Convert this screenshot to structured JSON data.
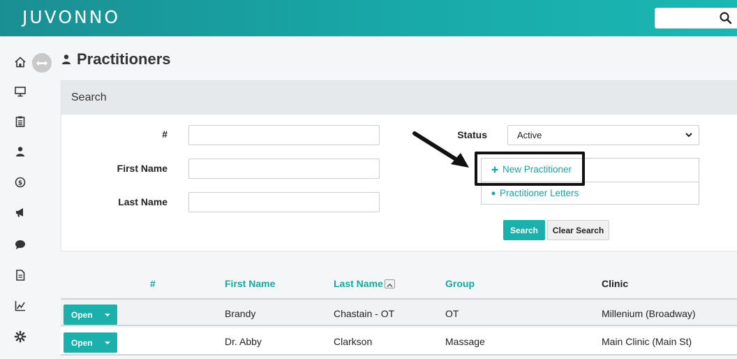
{
  "header": {
    "logo": "JUVONNO",
    "search_placeholder": ""
  },
  "sidebar": {
    "items": [
      {
        "icon": "home-icon"
      },
      {
        "icon": "monitor-icon"
      },
      {
        "icon": "clipboard-icon"
      },
      {
        "icon": "practitioners-icon"
      },
      {
        "icon": "billing-icon"
      },
      {
        "icon": "megaphone-icon"
      },
      {
        "icon": "chat-icon"
      },
      {
        "icon": "document-icon"
      },
      {
        "icon": "reports-icon"
      },
      {
        "icon": "gear-icon"
      }
    ]
  },
  "page": {
    "title": "Practitioners"
  },
  "search_panel": {
    "header": "Search",
    "fields": {
      "number_label": "#",
      "number_value": "",
      "first_name_label": "First Name",
      "first_name_value": "",
      "last_name_label": "Last Name",
      "last_name_value": ""
    },
    "status_label": "Status",
    "status_value": "Active",
    "actions": {
      "new_practitioner": "New Practitioner",
      "practitioner_letters": "Practitioner Letters"
    },
    "search_button": "Search",
    "clear_button": "Clear Search"
  },
  "table": {
    "headers": {
      "number": "#",
      "first_name": "First Name",
      "last_name": "Last Name",
      "group": "Group",
      "clinic": "Clinic"
    },
    "open_label": "Open",
    "rows": [
      {
        "number": "",
        "first_name": "Brandy",
        "last_name": "Chastain - OT",
        "group": "OT",
        "clinic": "Millenium (Broadway)"
      },
      {
        "number": "",
        "first_name": "Dr. Abby",
        "last_name": "Clarkson",
        "group": "Massage",
        "clinic": "Main Clinic (Main St)"
      }
    ]
  },
  "colors": {
    "accent": "#1bb0ac",
    "header_start": "#1a8f93",
    "header_end": "#1bb7b3"
  }
}
